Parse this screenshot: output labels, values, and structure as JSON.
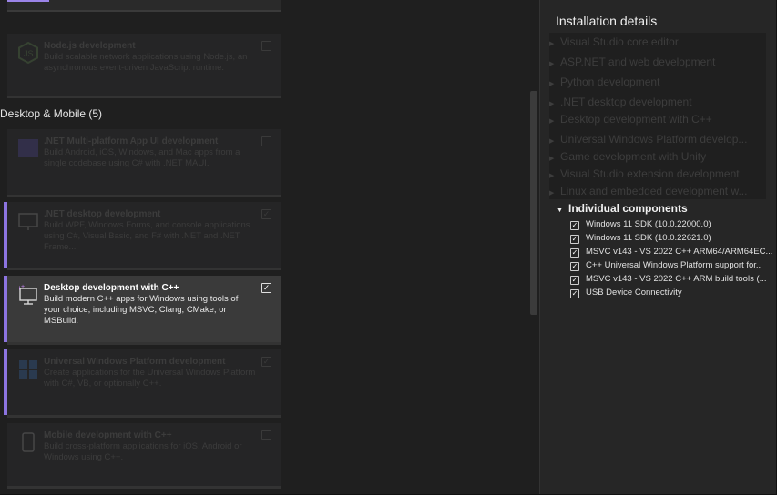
{
  "workloads": {
    "top_card": {
      "title": "Node.js development",
      "desc": "Build scalable network applications using Node.js, an asynchronous event-driven JavaScript runtime."
    },
    "section_title": "Desktop & Mobile (5)",
    "cards": [
      {
        "title": ".NET Multi-platform App UI development",
        "desc": "Build Android, iOS, Windows, and Mac apps from a single codebase using C# with .NET MAUI.",
        "checked": false
      },
      {
        "title": ".NET desktop development",
        "desc": "Build WPF, Windows Forms, and console applications using C#, Visual Basic, and F# with .NET and .NET Frame...",
        "checked": true
      },
      {
        "title": "Desktop development with C++",
        "desc": "Build modern C++ apps for Windows using tools of your choice, including MSVC, Clang, CMake, or MSBuild.",
        "checked": true
      },
      {
        "title": "Universal Windows Platform development",
        "desc": "Create applications for the Universal Windows Platform with C#, VB, or optionally C++.",
        "checked": true
      },
      {
        "title": "Mobile development with C++",
        "desc": "Build cross-platform applications for iOS, Android or Windows using C++.",
        "checked": false
      }
    ],
    "check_glyph": "✓"
  },
  "details": {
    "title": "Installation details",
    "dim_items": [
      "Visual Studio core editor",
      "ASP.NET and web development",
      "Python development",
      ".NET desktop development",
      "Desktop development with C++",
      "Universal Windows Platform develop...",
      "Game development with Unity",
      "Visual Studio extension development",
      "Linux and embedded development w..."
    ],
    "components_header": "Individual components",
    "components": [
      "Windows 11 SDK (10.0.22000.0)",
      "Windows 11 SDK (10.0.22621.0)",
      "MSVC v143 - VS 2022 C++ ARM64/ARM64EC...",
      "C++ Universal Windows Platform support for...",
      "MSVC v143 - VS 2022 C++ ARM build tools (...",
      "USB Device Connectivity"
    ]
  },
  "colors": {
    "accent": "#8c74e0",
    "panel": "#262626",
    "selected_card": "#3a3a3a"
  },
  "icons": [
    "nodejs-icon",
    "maui-icon",
    "dotnet-desktop-icon",
    "cpp-desktop-icon",
    "uwp-icon",
    "mobile-cpp-icon",
    "expand-triangle-icon",
    "checkbox-check-icon"
  ]
}
